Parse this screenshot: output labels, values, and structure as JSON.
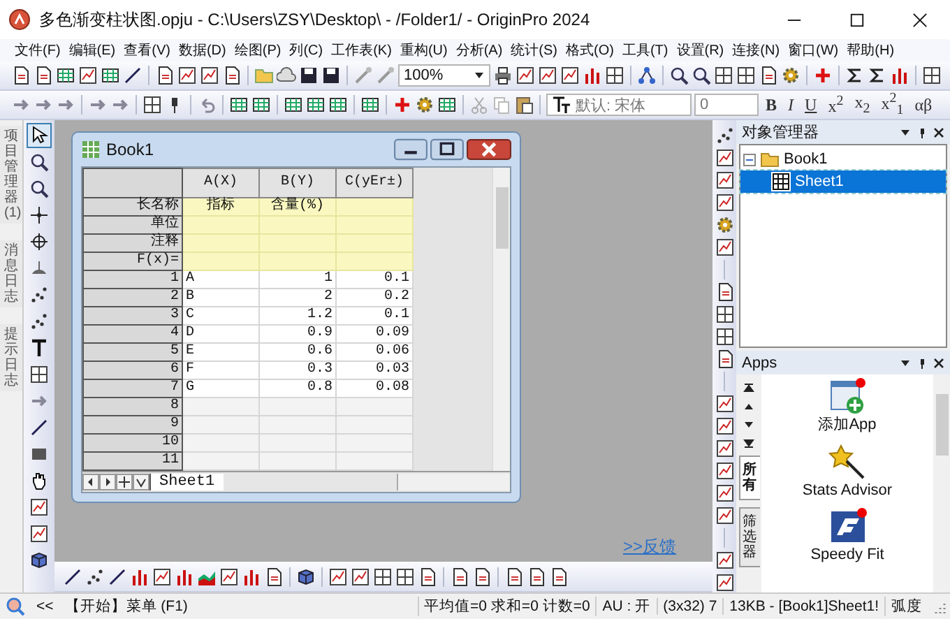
{
  "window": {
    "title": "多色渐变柱状图.opju - C:\\Users\\ZSY\\Desktop\\ - /Folder1/ - OriginPro 2024"
  },
  "menu": [
    "文件(F)",
    "编辑(E)",
    "查看(V)",
    "数据(D)",
    "绘图(P)",
    "列(C)",
    "工作表(K)",
    "重构(U)",
    "分析(A)",
    "统计(S)",
    "格式(O)",
    "工具(T)",
    "设置(R)",
    "连接(N)",
    "窗口(W)",
    "帮助(H)"
  ],
  "toolbar": {
    "zoom": "100%",
    "font": "默认: 宋体",
    "font_size": "0",
    "format_buttons": [
      {
        "kind": "bold",
        "label": "B"
      },
      {
        "kind": "italic",
        "label": "I"
      },
      {
        "kind": "underline",
        "label": "U"
      },
      {
        "kind": "plain",
        "label": "x$^{2}$"
      },
      {
        "kind": "plain",
        "label": "x$_{2}$"
      },
      {
        "kind": "plain",
        "label": "x$^{2}$$_{1}$"
      },
      {
        "kind": "plain",
        "label": "αβ"
      }
    ]
  },
  "side_tabs": [
    {
      "label": "项目管理器(1)"
    },
    {
      "label": "消息日志"
    },
    {
      "label": "提示日志"
    }
  ],
  "tools": [
    {
      "kind": "pointer",
      "selected": true
    },
    {
      "kind": "zoom",
      "selected": false
    },
    {
      "kind": "zoom",
      "selected": false
    },
    {
      "kind": "crosshair",
      "selected": false
    },
    {
      "kind": "target",
      "selected": false
    },
    {
      "kind": "scale",
      "selected": false
    },
    {
      "kind": "scatter",
      "selected": false
    },
    {
      "kind": "scatter",
      "selected": false
    },
    {
      "kind": "text",
      "selected": false
    },
    {
      "kind": "grid",
      "selected": false
    },
    {
      "kind": "arrow",
      "selected": false
    },
    {
      "kind": "line",
      "selected": false
    },
    {
      "kind": "rect",
      "selected": false
    },
    {
      "kind": "hand",
      "selected": false
    },
    {
      "kind": "chart",
      "selected": false
    },
    {
      "kind": "chart",
      "selected": false
    },
    {
      "kind": "cube",
      "selected": false
    }
  ],
  "workbook": {
    "title": "Book1",
    "columns": [
      "A(X)",
      "B(Y)",
      "C(yEr±)"
    ],
    "label_rows": [
      {
        "label": "长名称",
        "cells": [
          "指标",
          "含量(%)"
        ]
      },
      {
        "label": "单位"
      },
      {
        "label": "注释"
      },
      {
        "label": "F(x)="
      }
    ],
    "rows": [
      {
        "label": "1",
        "cells": [
          "A",
          "1",
          "0.1"
        ]
      },
      {
        "label": "2",
        "cells": [
          "B",
          "2",
          "0.2"
        ]
      },
      {
        "label": "3",
        "cells": [
          "C",
          "1.2",
          "0.1"
        ]
      },
      {
        "label": "4",
        "cells": [
          "D",
          "0.9",
          "0.09"
        ]
      },
      {
        "label": "5",
        "cells": [
          "E",
          "0.6",
          "0.06"
        ]
      },
      {
        "label": "6",
        "cells": [
          "F",
          "0.3",
          "0.03"
        ]
      },
      {
        "label": "7",
        "cells": [
          "G",
          "0.8",
          "0.08"
        ]
      },
      {
        "label": "8"
      },
      {
        "label": "9"
      },
      {
        "label": "10"
      },
      {
        "label": "11"
      }
    ],
    "sheets": [
      {
        "label": "Sheet1",
        "selected": true
      }
    ]
  },
  "feedback_link": ">>反馈",
  "object_manager": {
    "title": "对象管理器",
    "tree": [
      {
        "label": "Book1",
        "expanded": true,
        "selected": false,
        "children": [
          {
            "label": "Sheet1",
            "selected": true
          }
        ]
      }
    ]
  },
  "apps": {
    "title": "Apps",
    "tabs": [
      {
        "label": "所有",
        "selected": true
      },
      {
        "label": "筛选器",
        "selected": false
      }
    ],
    "items": [
      {
        "kind": "add",
        "label": "添加App"
      },
      {
        "kind": "wizard",
        "label": "Stats Advisor"
      },
      {
        "kind": "fit",
        "label": "Speedy Fit"
      }
    ]
  },
  "status_bar": {
    "toggle": "<<",
    "hint": "【开始】菜单 (F1)",
    "fields": [
      "平均值=0 求和=0 计数=0",
      "AU : 开",
      "(3x32) 7",
      "13KB - [Book1]Sheet1!",
      "弧度"
    ]
  }
}
